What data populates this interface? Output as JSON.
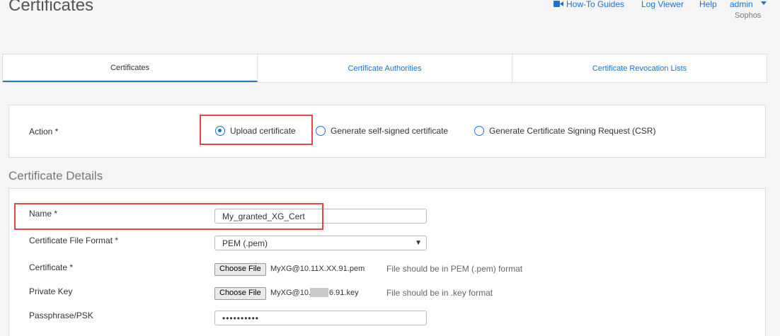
{
  "page": {
    "title": "Certificates"
  },
  "top_nav": {
    "how_to": "How-To Guides",
    "log_viewer": "Log Viewer",
    "help": "Help",
    "user": "admin",
    "org": "Sophos",
    "accent": "#1a73c8"
  },
  "tabs": [
    {
      "label": "Certificates",
      "active": true
    },
    {
      "label": "Certificate Authorities",
      "active": false
    },
    {
      "label": "Certificate Revocation Lists",
      "active": false
    }
  ],
  "action": {
    "label": "Action *",
    "options": [
      {
        "label": "Upload certificate",
        "selected": true
      },
      {
        "label": "Generate self-signed certificate",
        "selected": false
      },
      {
        "label": "Generate Certificate Signing Request (CSR)",
        "selected": false
      }
    ]
  },
  "details": {
    "section_title": "Certificate Details",
    "name_label": "Name *",
    "name_value": "My_granted_XG_Cert",
    "format_label": "Certificate File Format *",
    "format_value": "PEM (.pem)",
    "cert_label": "Certificate *",
    "cert_button": "Choose File",
    "cert_file": "MyXG@10.11X.XX.91.pem",
    "cert_hint": "File should be in PEM (.pem) format",
    "key_label": "Private Key",
    "key_button": "Choose File",
    "key_file_prefix": "MyXG@10.1",
    "key_file_suffix": "6.91.key",
    "key_hint": "File should be in .key format",
    "pass_label": "Passphrase/PSK",
    "pass_value": "••••••••••"
  },
  "colors": {
    "highlight": "#e04848",
    "tab_underline": "#2a7ac0"
  }
}
